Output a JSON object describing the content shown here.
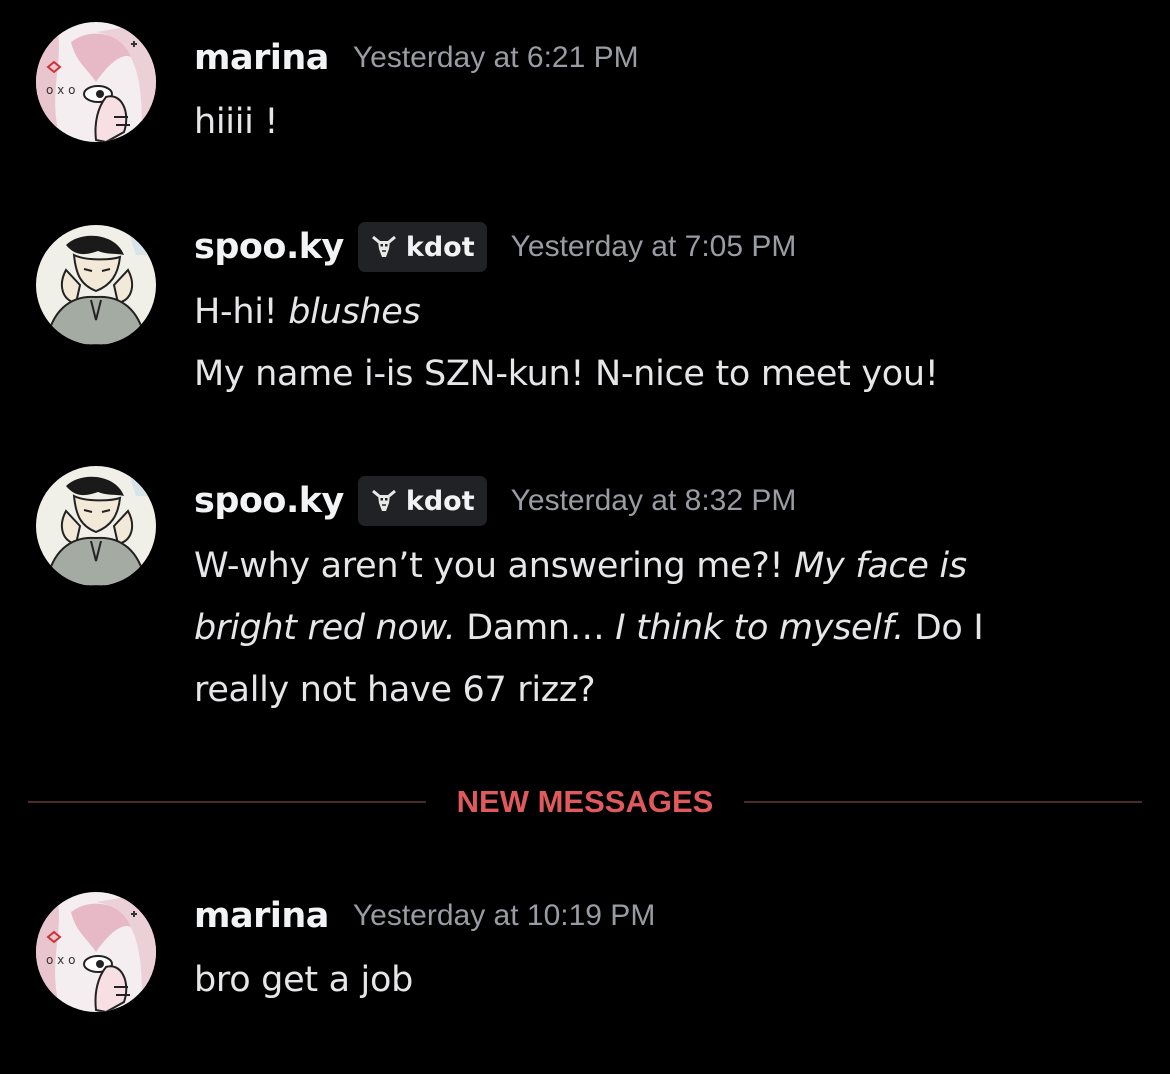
{
  "messages": [
    {
      "author": "marina",
      "timestamp": "Yesterday at 6:21 PM",
      "lines": [
        "hiiii !"
      ]
    },
    {
      "author": "spoo.ky",
      "tag": "kdot",
      "timestamp": "Yesterday at 7:05 PM",
      "line1_plain": "H-hi! ",
      "line1_italic": "blushes",
      "line2": "My name i-is SZN-kun! N-nice to meet you!"
    },
    {
      "author": "spoo.ky",
      "tag": "kdot",
      "timestamp": "Yesterday at 8:32 PM",
      "line1_plain": "W-why aren’t you answering me?! ",
      "line1_italic": "My face is",
      "line2_italic_a": "bright red now.",
      "line2_plain_a": " Damn… ",
      "line2_italic_b": "I think to myself.",
      "line2_plain_b": " Do I",
      "line3": "really not have 67 rizz?"
    }
  ],
  "divider": {
    "label": "NEW MESSAGES",
    "color": "#e0595d"
  },
  "new_messages": [
    {
      "author": "marina",
      "timestamp": "Yesterday at 10:19 PM",
      "lines": [
        "bro get a job"
      ]
    }
  ],
  "icons": {
    "tag_icon": "goat-skull-icon",
    "avatar_marina": "anime-girl-avatar",
    "avatar_spooky": "manga-guy-avatar"
  }
}
